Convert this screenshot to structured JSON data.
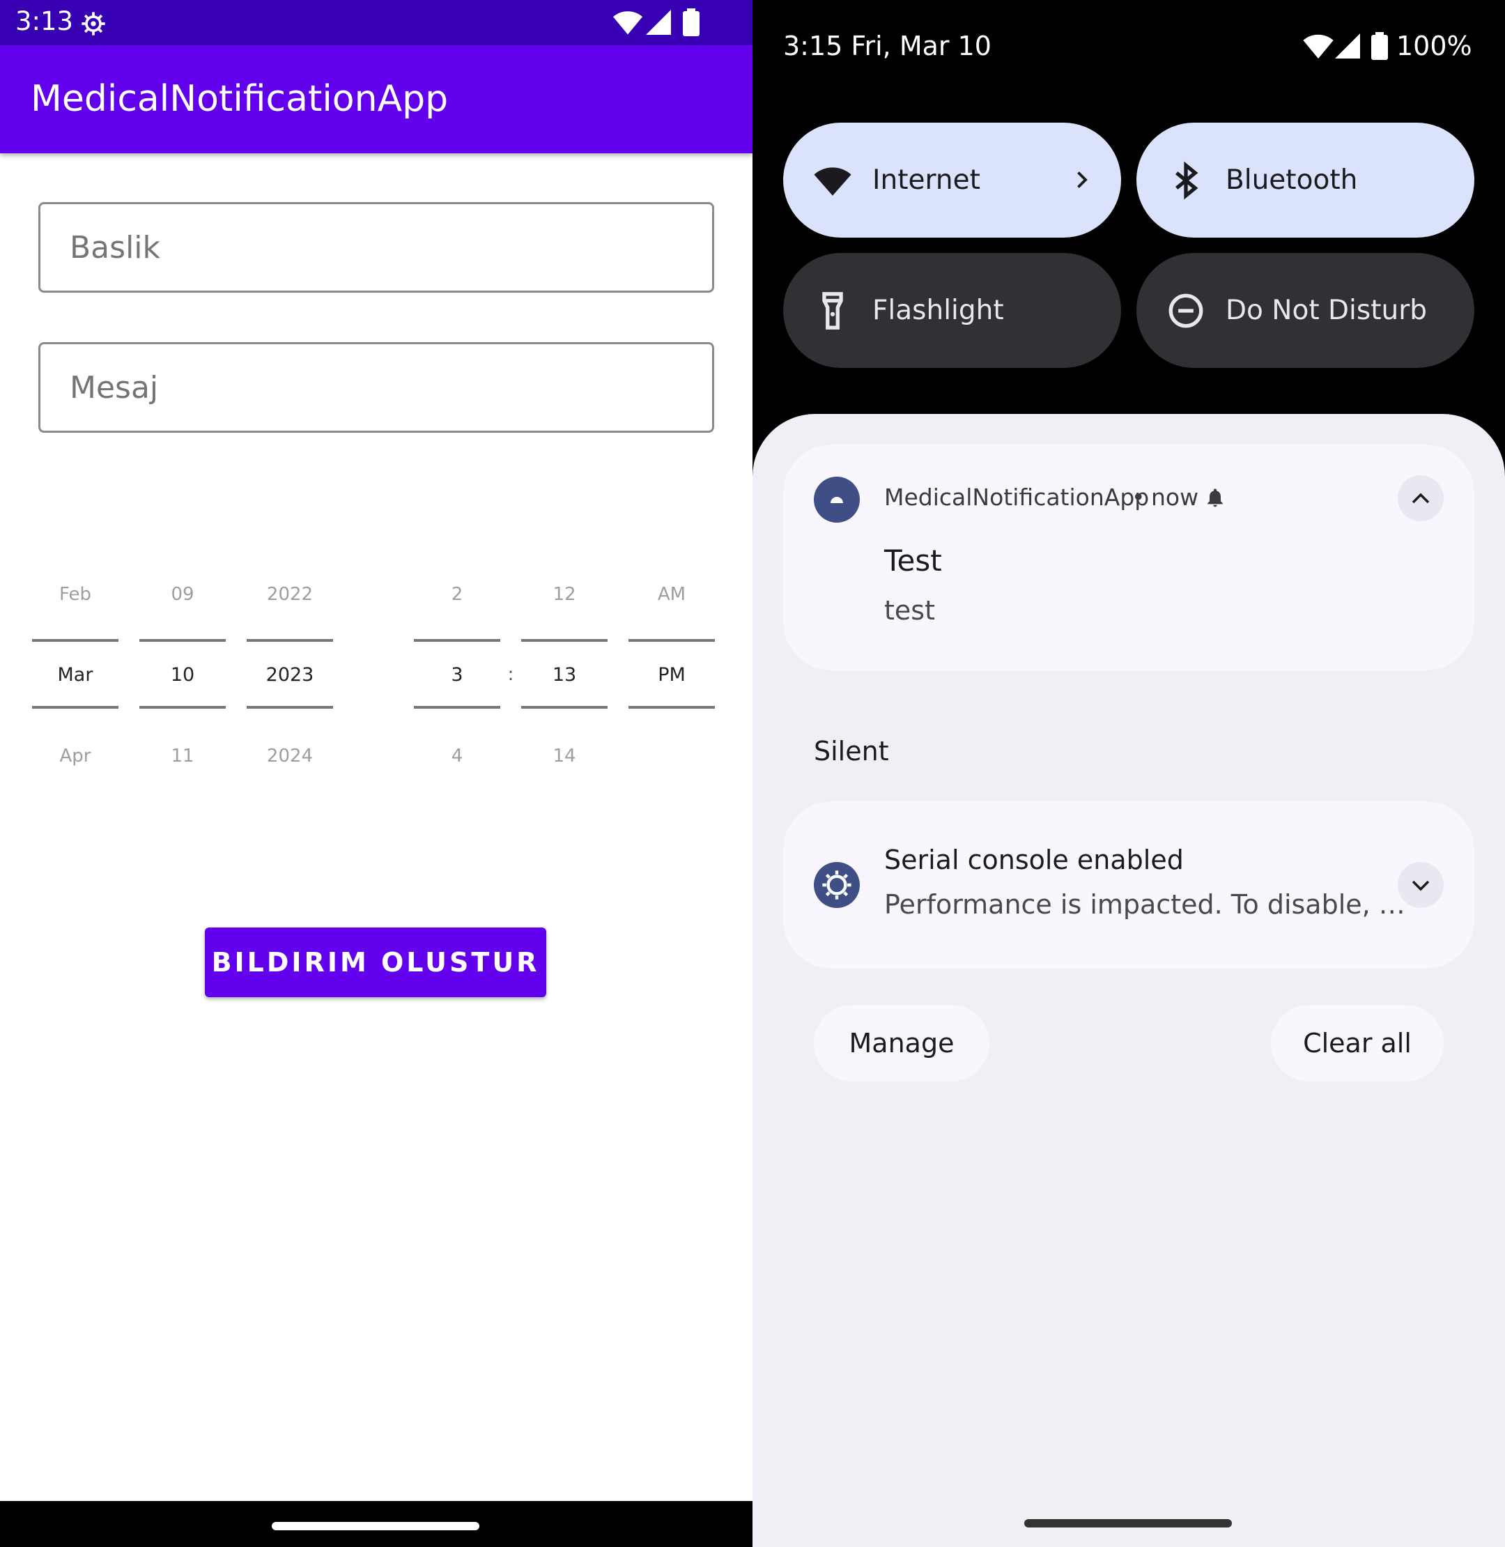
{
  "app": {
    "status_time": "3:13",
    "title": "MedicalNotificationApp",
    "title_field_placeholder": "Baslik",
    "message_field_placeholder": "Mesaj",
    "date_picker": {
      "month": {
        "prev": "Feb",
        "current": "Mar",
        "next": "Apr"
      },
      "day": {
        "prev": "09",
        "current": "10",
        "next": "11"
      },
      "year": {
        "prev": "2022",
        "current": "2023",
        "next": "2024"
      }
    },
    "time_picker": {
      "hour": {
        "prev": "2",
        "current": "3",
        "next": "4"
      },
      "separator": ":",
      "minute": {
        "prev": "12",
        "current": "13",
        "next": "14"
      },
      "ampm": {
        "prev": "AM",
        "current": "PM"
      }
    },
    "create_button": "BILDIRIM OLUSTUR"
  },
  "shade": {
    "status_time": "3:15 Fri, Mar 10",
    "battery": "100%",
    "tiles": [
      {
        "label": "Internet",
        "icon": "wifi-icon",
        "active": true
      },
      {
        "label": "Bluetooth",
        "icon": "bluetooth-icon",
        "active": true
      },
      {
        "label": "Flashlight",
        "icon": "flashlight-icon",
        "active": false
      },
      {
        "label": "Do Not Disturb",
        "icon": "dnd-icon",
        "active": false
      }
    ],
    "notification": {
      "app": "MedicalNotificationApp",
      "when": "now",
      "title": "Test",
      "text": "test"
    },
    "silent_header": "Silent",
    "silent_notification": {
      "title": "Serial console enabled",
      "text": "Performance is impacted. To disable, …"
    },
    "manage_label": "Manage",
    "clear_all_label": "Clear all"
  },
  "colors": {
    "status_bar": "#3700b3",
    "primary": "#6200ee",
    "tile_active": "#dbe2fb",
    "tile_inactive": "#313135",
    "sheet": "#f1eff6"
  }
}
